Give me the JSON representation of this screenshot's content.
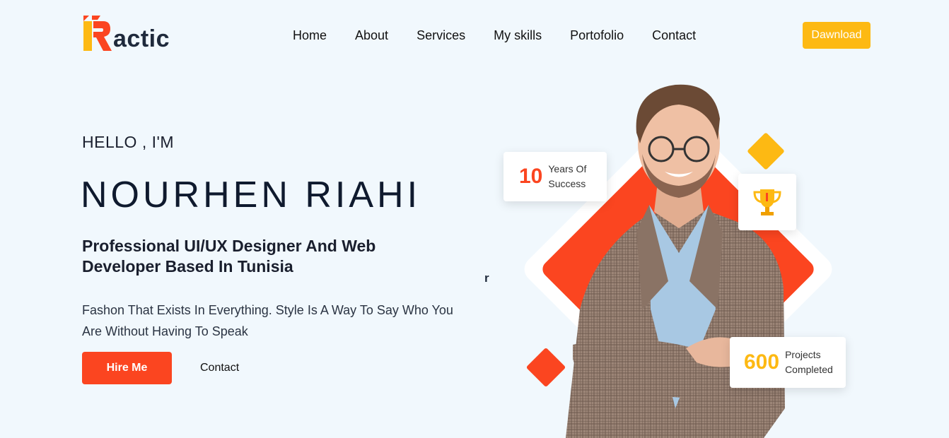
{
  "brand": {
    "logo_letter": "R",
    "logo_text": "actic"
  },
  "nav": {
    "items": [
      "Home",
      "About",
      "Services",
      "My skills",
      "Portofolio",
      "Contact"
    ],
    "download_label": "Dawnload"
  },
  "hero": {
    "greeting": "HELLO , I'M",
    "name": "NOURHEN RIAHI",
    "headline_line1": "Professional UI/UX Designer And Web",
    "headline_line2": "Developer Based In Tunisia",
    "description_line1": "Fashon That Exists In Everything. Style Is A Way To Say Who You",
    "description_line2": "Are Without Having To Speak",
    "hire_label": "Hire Me",
    "contact_label": "Contact",
    "stray_char": "r"
  },
  "stats": {
    "years": {
      "number": "10",
      "line1": "Years Of",
      "line2": "Success"
    },
    "projects": {
      "number": "600",
      "line1": "Projects",
      "line2": "Completed"
    },
    "trophy_icon": "trophy-icon"
  },
  "colors": {
    "accent_red": "#fb4520",
    "accent_yellow": "#fdb913",
    "background": "#f1f8fd",
    "dark_text": "#0f1a2e"
  }
}
